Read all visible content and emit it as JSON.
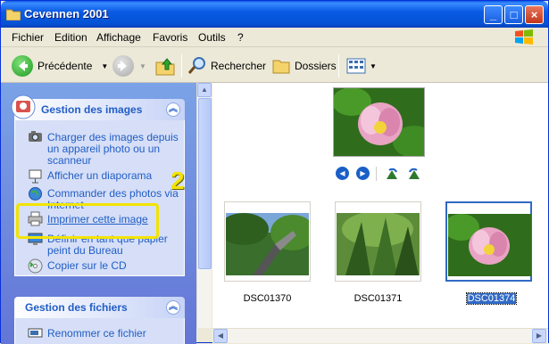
{
  "window": {
    "title": "Cevennen 2001"
  },
  "menu": [
    "Fichier",
    "Edition",
    "Affichage",
    "Favoris",
    "Outils",
    "?"
  ],
  "toolbar": {
    "back_label": "Précédente",
    "search_label": "Rechercher",
    "folders_label": "Dossiers"
  },
  "sidebar": {
    "image_tasks": {
      "title": "Gestion des images",
      "items": [
        "Charger des images depuis un appareil photo ou un scanneur",
        "Afficher un diaporama",
        "Commander des photos via Internet",
        "Imprimer cette image",
        "Définir en tant que papier peint du Bureau",
        "Copier sur le CD"
      ]
    },
    "file_tasks": {
      "title": "Gestion des fichiers",
      "items": [
        "Renommer ce fichier"
      ]
    }
  },
  "annotation": {
    "step_number": "2",
    "highlight_color": "#f2e300"
  },
  "thumbnails": [
    {
      "name": "DSC01370",
      "selected": false
    },
    {
      "name": "DSC01371",
      "selected": false
    },
    {
      "name": "DSC01374",
      "selected": true
    }
  ],
  "colors": {
    "titlebar": "#0a5be5",
    "link": "#215dc6",
    "selection": "#316ac5"
  }
}
